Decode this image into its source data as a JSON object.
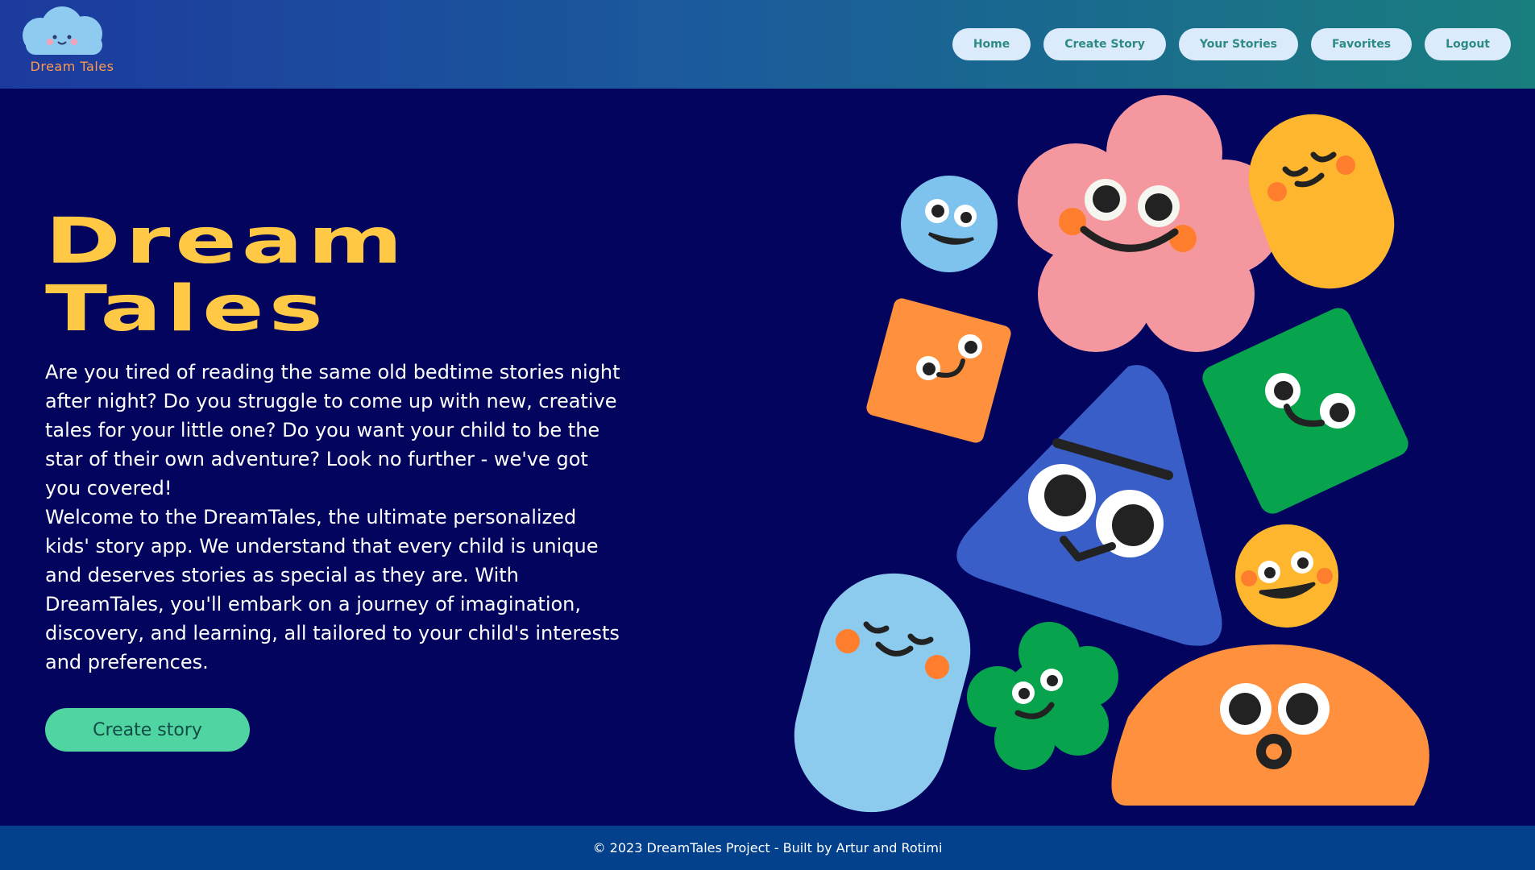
{
  "logo": {
    "text": "Dream Tales"
  },
  "nav": {
    "home": "Home",
    "create_story": "Create Story",
    "your_stories": "Your Stories",
    "favorites": "Favorites",
    "logout": "Logout"
  },
  "hero": {
    "title_line1": "Dream",
    "title_line2": "Tales",
    "paragraph1": "Are you tired of reading the same old bedtime stories night after night? Do you struggle to come up with new, creative tales for your little one? Do you want your child to be the star of their own adventure? Look no further - we've got you covered!",
    "paragraph2": "Welcome to the DreamTales, the ultimate personalized kids' story app. We understand that every child is unique and deserves stories as special as they are. With DreamTales, you'll embark on a journey of imagination, discovery, and learning, all tailored to your child's interests and preferences.",
    "cta_label": "Create story"
  },
  "footer": {
    "text": "© 2023 DreamTales Project - Built by Artur and Rotimi"
  },
  "colors": {
    "background": "#02045e",
    "title": "#ffc845",
    "cta": "#4fd4a2",
    "footer": "#03418d",
    "nav_button": "#dcebfb"
  },
  "illustration": {
    "characters": [
      "blue-circle-face",
      "pink-flower-face",
      "yellow-capsule-face",
      "orange-square-face",
      "green-square-face",
      "blue-triangle-face",
      "yellow-circle-face",
      "light-blue-capsule-face",
      "green-flower-face",
      "orange-half-dome-face"
    ]
  }
}
